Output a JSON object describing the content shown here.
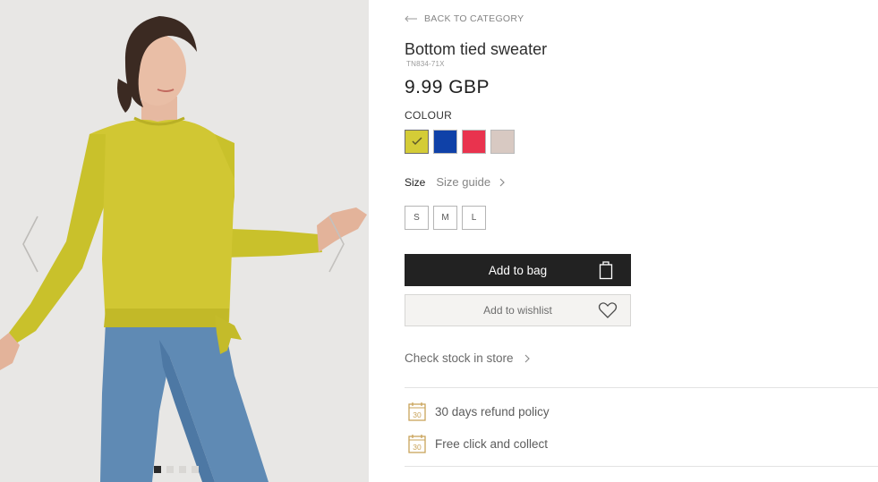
{
  "gallery": {
    "dots_count": 4,
    "active_dot": 0
  },
  "product": {
    "back_label": "BACK TO CATEGORY",
    "title": "Bottom tied sweater",
    "sku": "TN834-71X",
    "price": "9.99 GBP",
    "colour_label": "COLOUR",
    "colours": [
      {
        "hex": "#d4cc37",
        "selected": true
      },
      {
        "hex": "#0f41a8",
        "selected": false
      },
      {
        "hex": "#e9334e",
        "selected": false
      },
      {
        "hex": "#d8c9c2",
        "selected": false
      }
    ],
    "size_label": "Size",
    "size_guide_label": "Size guide",
    "sizes": [
      "S",
      "M",
      "L"
    ],
    "add_to_bag_label": "Add to bag",
    "wishlist_label": "Add to wishlist",
    "stock_label": "Check stock in store"
  },
  "perks": [
    {
      "icon": "calendar-30-icon",
      "badge": "30",
      "label": "30 days refund policy"
    },
    {
      "icon": "calendar-30-icon",
      "badge": "30",
      "label": "Free click and collect"
    }
  ],
  "colors": {
    "accent_gold": "#c9a35a",
    "button_dark": "#222222"
  }
}
